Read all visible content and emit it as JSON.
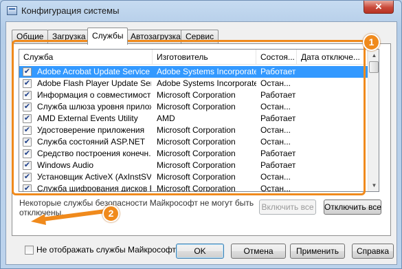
{
  "window": {
    "title": "Конфигурация системы",
    "close_glyph": "✕",
    "icon": "msconfig-icon"
  },
  "tabs": [
    {
      "label": "Общие",
      "active": false
    },
    {
      "label": "Загрузка",
      "active": false
    },
    {
      "label": "Службы",
      "active": true
    },
    {
      "label": "Автозагрузка",
      "active": false
    },
    {
      "label": "Сервис",
      "active": false
    }
  ],
  "services": {
    "columns": [
      "Служба",
      "Изготовитель",
      "Состоя...",
      "Дата отключе..."
    ],
    "rows": [
      {
        "name": "Adobe Acrobat Update Service",
        "maker": "Adobe Systems Incorporated",
        "status": "Работает",
        "checked": true
      },
      {
        "name": "Adobe Flash Player Update Service",
        "maker": "Adobe Systems Incorporated",
        "status": "Остан...",
        "checked": true
      },
      {
        "name": "Информация о совместимости ...",
        "maker": "Microsoft Corporation",
        "status": "Работает",
        "checked": true
      },
      {
        "name": "Служба шлюза уровня прилож...",
        "maker": "Microsoft Corporation",
        "status": "Остан...",
        "checked": true
      },
      {
        "name": "AMD External Events Utility",
        "maker": "AMD",
        "status": "Работает",
        "checked": true
      },
      {
        "name": "Удостоверение приложения",
        "maker": "Microsoft Corporation",
        "status": "Остан...",
        "checked": true
      },
      {
        "name": "Служба состояний ASP.NET",
        "maker": "Microsoft Corporation",
        "status": "Остан...",
        "checked": true
      },
      {
        "name": "Средство построения конечн...",
        "maker": "Microsoft Corporation",
        "status": "Работает",
        "checked": true
      },
      {
        "name": "Windows Audio",
        "maker": "Microsoft Corporation",
        "status": "Работает",
        "checked": true
      },
      {
        "name": "Установщик ActiveX (AxInstSV)",
        "maker": "Microsoft Corporation",
        "status": "Остан...",
        "checked": true
      },
      {
        "name": "Служба шифрования дисков Bi...",
        "maker": "Microsoft Corporation",
        "status": "Остан...",
        "checked": true
      }
    ],
    "selected_index": 0,
    "check_glyph": "✔",
    "scroll_up_glyph": "▲",
    "scroll_down_glyph": "▼"
  },
  "note": "Некоторые службы безопасности Майкрософт не могут быть отключены.",
  "buttons": {
    "enable_all": "Включить все",
    "disable_all": "Отключить все",
    "ok": "OK",
    "cancel": "Отмена",
    "apply": "Применить",
    "help": "Справка"
  },
  "hide_ms": {
    "label": "Не отображать службы Майкрософт",
    "checked": false
  },
  "annotations": {
    "badge1": "1",
    "badge2": "2",
    "color": "#f08a1c"
  }
}
